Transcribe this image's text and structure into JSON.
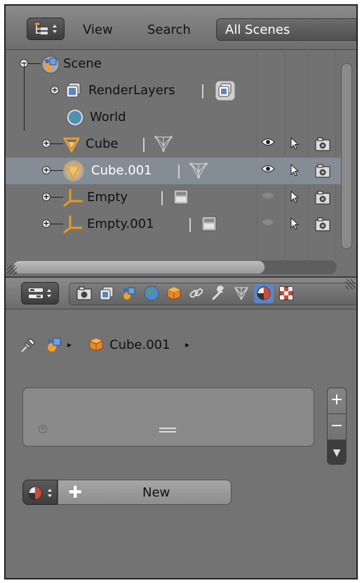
{
  "outliner": {
    "header": {
      "view_menu": "View",
      "search_menu": "Search",
      "scene_dropdown": "All Scenes"
    },
    "rows": [
      {
        "label": "Scene",
        "icon": "scene-icon"
      },
      {
        "label": "RenderLayers",
        "icon": "render-layers-icon"
      },
      {
        "label": "World",
        "icon": "world-icon"
      },
      {
        "label": "Cube",
        "icon": "mesh-object-icon",
        "visible": true
      },
      {
        "label": "Cube.001",
        "icon": "mesh-object-icon",
        "visible": true,
        "selected": true
      },
      {
        "label": "Empty",
        "icon": "empty-object-icon",
        "visible": false
      },
      {
        "label": "Empty.001",
        "icon": "empty-object-icon",
        "visible": false
      }
    ]
  },
  "properties": {
    "tabs": [
      "render-tab",
      "render-layers-tab",
      "scene-tab",
      "world-tab",
      "object-tab",
      "constraints-tab",
      "modifiers-tab",
      "data-tab",
      "material-tab",
      "texture-tab"
    ],
    "active_tab": "material-tab",
    "breadcrumb": {
      "object": "Cube.001"
    },
    "material_slot_buttons": {
      "add": "+",
      "remove": "−",
      "menu": "▼"
    },
    "new_button_label": "New"
  },
  "colors": {
    "panel_bg": "#737373",
    "selection": "#848c96",
    "active_tab": "#5b86c0",
    "mesh_orange": "#f0a030",
    "empty_orange": "#e89a20"
  }
}
